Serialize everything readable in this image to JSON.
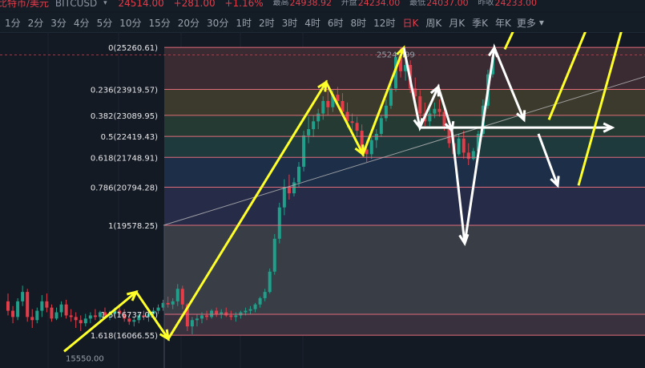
{
  "header": {
    "title": "比特币/美元",
    "symbol": "BITCUSD",
    "caret": "▾",
    "price": "24514.00",
    "change": "+281.00",
    "change_pct": "+1.16%",
    "high_label": "最高",
    "high_value": "24938.92",
    "open_label": "开盘",
    "open_value": "24234.00",
    "low_label": "最低",
    "low_value": "24037.00",
    "prev_label": "昨收",
    "prev_value": "24233.00"
  },
  "timeframes": [
    "1分",
    "2分",
    "3分",
    "4分",
    "5分",
    "10分",
    "15分",
    "20分",
    "30分",
    "1时",
    "2时",
    "3时",
    "4时",
    "6时",
    "8时",
    "12时",
    "日K",
    "周K",
    "月K",
    "季K",
    "年K"
  ],
  "active_timeframe": "日K",
  "more_label": "更多",
  "more_caret": "▾",
  "colors": {
    "background": "#131a24",
    "up_candle": "#20a08a",
    "down_candle": "#e33d4a",
    "fib_line": "#e06c7a",
    "arrow_yellow": "#ffff2a",
    "arrow_white": "#ffffff"
  },
  "chart_data": {
    "type": "candlestick",
    "ylim": [
      15200,
      25700
    ],
    "fib_levels": [
      {
        "label": "0(25260.61)",
        "value": 25260.61,
        "fill": "#3a2a31"
      },
      {
        "label": "0.236(23919.57)",
        "value": 23919.57,
        "fill": "#3b3a2c"
      },
      {
        "label": "0.382(23089.95)",
        "value": 23089.95,
        "fill": "#243a32"
      },
      {
        "label": "0.5(22419.43)",
        "value": 22419.43,
        "fill": "#1e3a3d"
      },
      {
        "label": "0.618(21748.91)",
        "value": 21748.91,
        "fill": "#1d2e48"
      },
      {
        "label": "0.786(20794.28)",
        "value": 20794.28,
        "fill": "#262b48"
      },
      {
        "label": "1(19578.25)",
        "value": 19578.25,
        "fill": "#393d46"
      },
      {
        "label": "1.5(16737.07)",
        "value": 16737.07,
        "fill": "#39313d"
      },
      {
        "label": "1.618(16066.55)",
        "value": 16066.55,
        "fill": null
      }
    ],
    "annotations": [
      {
        "text": "25249.99",
        "value": 25249.99
      },
      {
        "text": "15550.00",
        "value": 15550.0
      }
    ],
    "candles": [
      [
        17150,
        17400,
        16700,
        16850
      ],
      [
        16850,
        17000,
        16450,
        16650
      ],
      [
        16650,
        17250,
        16550,
        17150
      ],
      [
        17150,
        17650,
        17000,
        17450
      ],
      [
        17450,
        17550,
        16500,
        16650
      ],
      [
        16650,
        16900,
        16300,
        16550
      ],
      [
        16550,
        16950,
        16450,
        16850
      ],
      [
        16850,
        17350,
        16650,
        17150
      ],
      [
        17150,
        17400,
        16800,
        16950
      ],
      [
        16950,
        17050,
        16500,
        16600
      ],
      [
        16600,
        16950,
        16550,
        16800
      ],
      [
        16800,
        17150,
        16650,
        17050
      ],
      [
        17050,
        17200,
        16600,
        16700
      ],
      [
        16700,
        16900,
        16500,
        16650
      ],
      [
        16650,
        16800,
        16300,
        16550
      ],
      [
        16550,
        16700,
        16200,
        16450
      ],
      [
        16450,
        16750,
        16350,
        16600
      ],
      [
        16600,
        16800,
        16450,
        16700
      ],
      [
        16700,
        16900,
        16550,
        16650
      ],
      [
        16650,
        16850,
        16500,
        16800
      ],
      [
        16800,
        16950,
        16600,
        16700
      ],
      [
        16700,
        16850,
        16550,
        16750
      ],
      [
        16750,
        16950,
        16650,
        16850
      ],
      [
        16850,
        17050,
        16700,
        16750
      ],
      [
        16750,
        16900,
        16500,
        16600
      ],
      [
        16600,
        16750,
        16400,
        16500
      ],
      [
        16500,
        16650,
        16350,
        16550
      ],
      [
        16550,
        16800,
        16450,
        16700
      ],
      [
        16700,
        16850,
        16550,
        16650
      ],
      [
        16650,
        16800,
        16500,
        16750
      ],
      [
        16750,
        16950,
        16650,
        16850
      ],
      [
        16850,
        17050,
        16750,
        16950
      ],
      [
        16950,
        17200,
        16850,
        17100
      ],
      [
        17100,
        17300,
        16950,
        17050
      ],
      [
        17050,
        17250,
        16900,
        17150
      ],
      [
        17150,
        17700,
        17000,
        17550
      ],
      [
        17550,
        17650,
        16900,
        17050
      ],
      [
        17050,
        17100,
        16200,
        16350
      ],
      [
        16350,
        16650,
        16100,
        16550
      ],
      [
        16550,
        16750,
        16350,
        16600
      ],
      [
        16600,
        16800,
        16450,
        16700
      ],
      [
        16700,
        16850,
        16550,
        16650
      ],
      [
        16650,
        16900,
        16600,
        16850
      ],
      [
        16850,
        16950,
        16650,
        16750
      ],
      [
        16750,
        16900,
        16600,
        16800
      ],
      [
        16800,
        16950,
        16650,
        16700
      ],
      [
        16700,
        16850,
        16550,
        16650
      ],
      [
        16650,
        16800,
        16500,
        16700
      ],
      [
        16700,
        16850,
        16600,
        16800
      ],
      [
        16800,
        16950,
        16700,
        16850
      ],
      [
        16850,
        17000,
        16750,
        16900
      ],
      [
        16900,
        17100,
        16800,
        17050
      ],
      [
        17050,
        17300,
        16950,
        17250
      ],
      [
        17250,
        17550,
        17150,
        17450
      ],
      [
        17450,
        18200,
        17400,
        18100
      ],
      [
        18100,
        19300,
        18000,
        19150
      ],
      [
        19150,
        20300,
        19000,
        20150
      ],
      [
        20150,
        21050,
        19900,
        20800
      ],
      [
        20800,
        21200,
        20400,
        20600
      ],
      [
        20600,
        21100,
        20500,
        20950
      ],
      [
        20950,
        21600,
        20800,
        21450
      ],
      [
        21450,
        22600,
        21300,
        22450
      ],
      [
        22450,
        23050,
        22200,
        22650
      ],
      [
        22650,
        23100,
        22400,
        22900
      ],
      [
        22900,
        23300,
        22650,
        23150
      ],
      [
        23150,
        23700,
        22950,
        23550
      ],
      [
        23550,
        23950,
        23100,
        23350
      ],
      [
        23350,
        23900,
        23200,
        23750
      ],
      [
        23750,
        24000,
        23400,
        23550
      ],
      [
        23550,
        23800,
        23050,
        23200
      ],
      [
        23200,
        23500,
        22700,
        22900
      ],
      [
        22900,
        23150,
        22600,
        22850
      ],
      [
        22850,
        23050,
        22400,
        22600
      ],
      [
        22600,
        22800,
        21800,
        22000
      ],
      [
        22000,
        22300,
        21600,
        21850
      ],
      [
        21850,
        22400,
        21700,
        22300
      ],
      [
        22300,
        22650,
        22050,
        22500
      ],
      [
        22500,
        23100,
        22400,
        23000
      ],
      [
        23000,
        23600,
        22900,
        23400
      ],
      [
        23400,
        24100,
        23300,
        23950
      ],
      [
        23950,
        25100,
        23850,
        24950
      ],
      [
        24950,
        25250,
        24300,
        24500
      ],
      [
        24500,
        24900,
        24200,
        24700
      ],
      [
        24700,
        24850,
        23800,
        23950
      ],
      [
        23950,
        24300,
        23500,
        23700
      ],
      [
        23700,
        23900,
        23000,
        23150
      ],
      [
        23150,
        23500,
        22750,
        22900
      ],
      [
        22900,
        23300,
        22750,
        23150
      ],
      [
        23150,
        23500,
        23000,
        23300
      ],
      [
        23300,
        23600,
        23050,
        23200
      ],
      [
        23200,
        23400,
        22600,
        22750
      ],
      [
        22750,
        22900,
        22050,
        22200
      ],
      [
        22200,
        22400,
        21700,
        21850
      ],
      [
        21850,
        22500,
        21800,
        22350
      ],
      [
        22350,
        22600,
        21700,
        21900
      ],
      [
        21900,
        22200,
        21500,
        21700
      ],
      [
        21700,
        22050,
        21650,
        21950
      ],
      [
        21950,
        22600,
        21900,
        22500
      ],
      [
        22500,
        23600,
        22400,
        23400
      ],
      [
        23400,
        24550,
        23300,
        24400
      ],
      [
        24400,
        25100,
        24300,
        24950
      ]
    ],
    "arrows": [
      {
        "color": "yellow",
        "points": [
          [
            15550,
            0
          ],
          [
            17450,
            1
          ],
          [
            15950,
            2
          ],
          [
            24150,
            3
          ],
          [
            21850,
            4
          ],
          [
            25250,
            5
          ]
        ]
      },
      {
        "color": "white",
        "points": [
          [
            25250,
            0
          ],
          [
            22700,
            1
          ],
          [
            24000,
            2
          ],
          [
            22600,
            3
          ],
          [
            19000,
            4
          ],
          [
            25250,
            5
          ],
          [
            22950,
            6
          ]
        ]
      },
      {
        "color": "white",
        "points": [
          [
            22700,
            0
          ],
          [
            22700,
            1
          ]
        ]
      },
      {
        "color": "yellow",
        "points": [
          [
            25200,
            0
          ],
          [
            27500,
            1
          ]
        ]
      },
      {
        "color": "yellow",
        "points": [
          [
            22950,
            0
          ],
          [
            27500,
            1
          ]
        ]
      },
      {
        "color": "white",
        "points": [
          [
            22500,
            0
          ],
          [
            20850,
            1
          ]
        ]
      },
      {
        "color": "yellow",
        "points": [
          [
            20850,
            0
          ],
          [
            27500,
            1
          ]
        ]
      }
    ]
  }
}
